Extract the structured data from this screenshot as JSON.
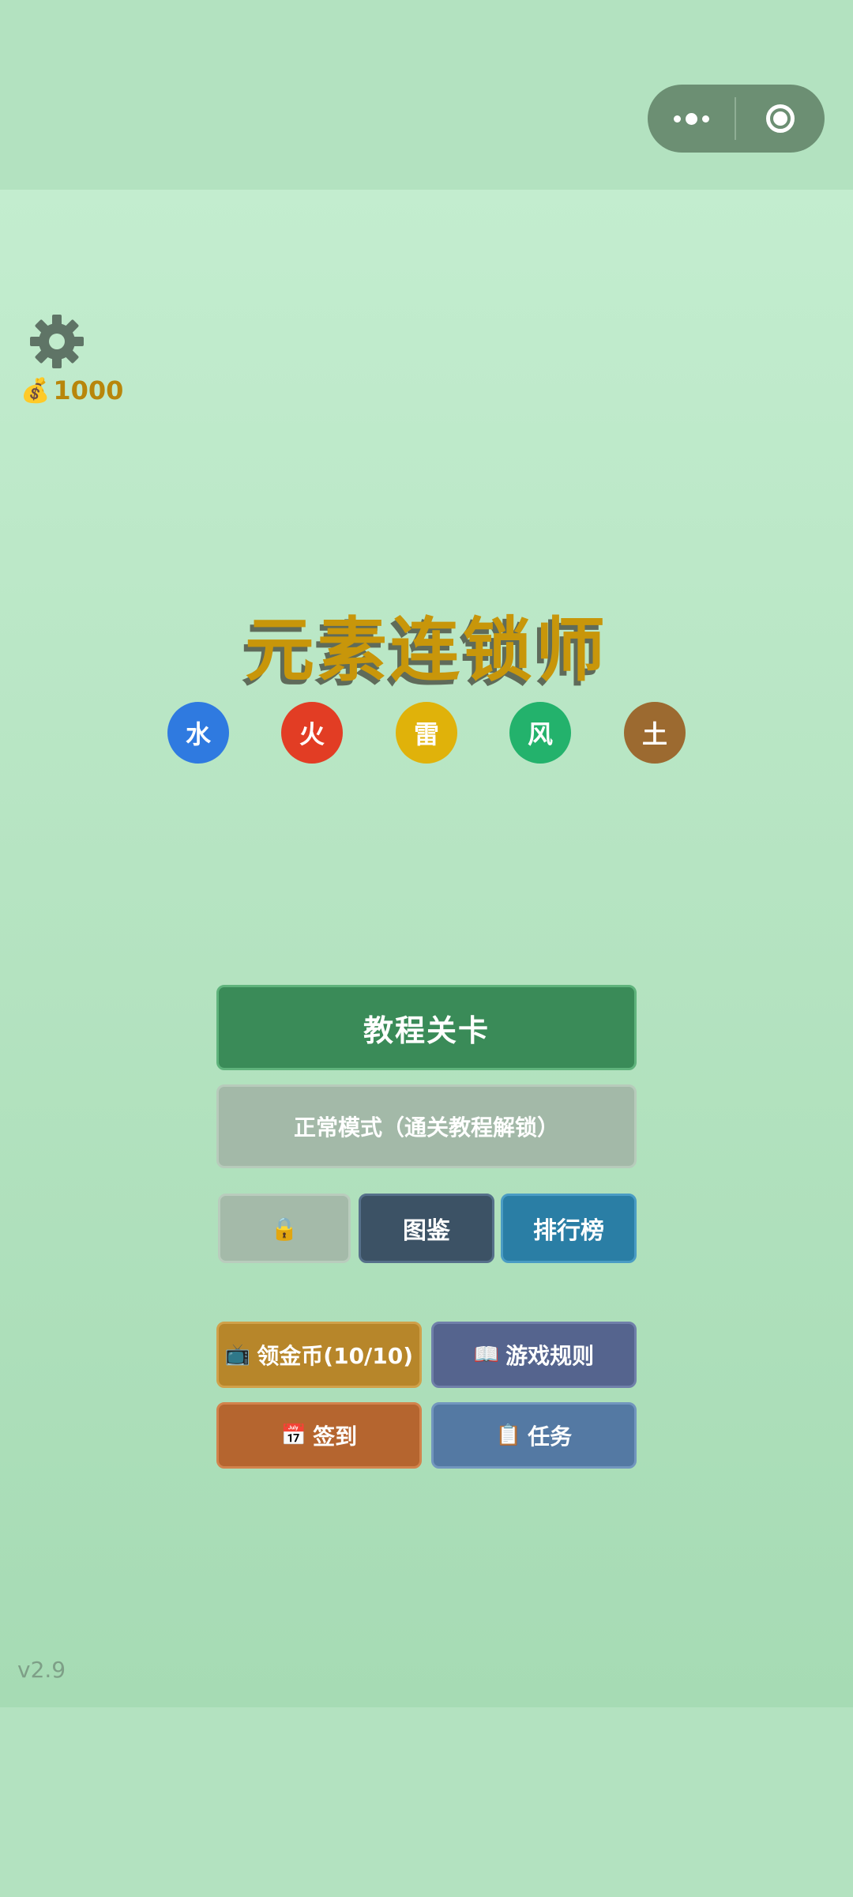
{
  "coins": {
    "amount": "1000",
    "icon": "money-bag-icon"
  },
  "title": "元素连锁师",
  "elements": [
    {
      "label": "水",
      "color": "#2f7ae0"
    },
    {
      "label": "火",
      "color": "#e23d24"
    },
    {
      "label": "雷",
      "color": "#e0b20a"
    },
    {
      "label": "风",
      "color": "#23b26c"
    },
    {
      "label": "土",
      "color": "#9c6a30"
    }
  ],
  "buttons": {
    "tutorial": "教程关卡",
    "normal": "正常模式（通关教程解锁）",
    "lock_icon": "🔒",
    "codex": "图鉴",
    "ranking": "排行榜",
    "watch_ad_icon": "📺",
    "watch_ad": "领金币(10/10)",
    "rules_icon": "📖",
    "rules": "游戏规则",
    "signin_icon": "📅",
    "signin": "签到",
    "tasks_icon": "📋",
    "tasks": "任务"
  },
  "version": "v2.9",
  "colors": {
    "title": "#c8960a",
    "coins": "#b8860b"
  }
}
